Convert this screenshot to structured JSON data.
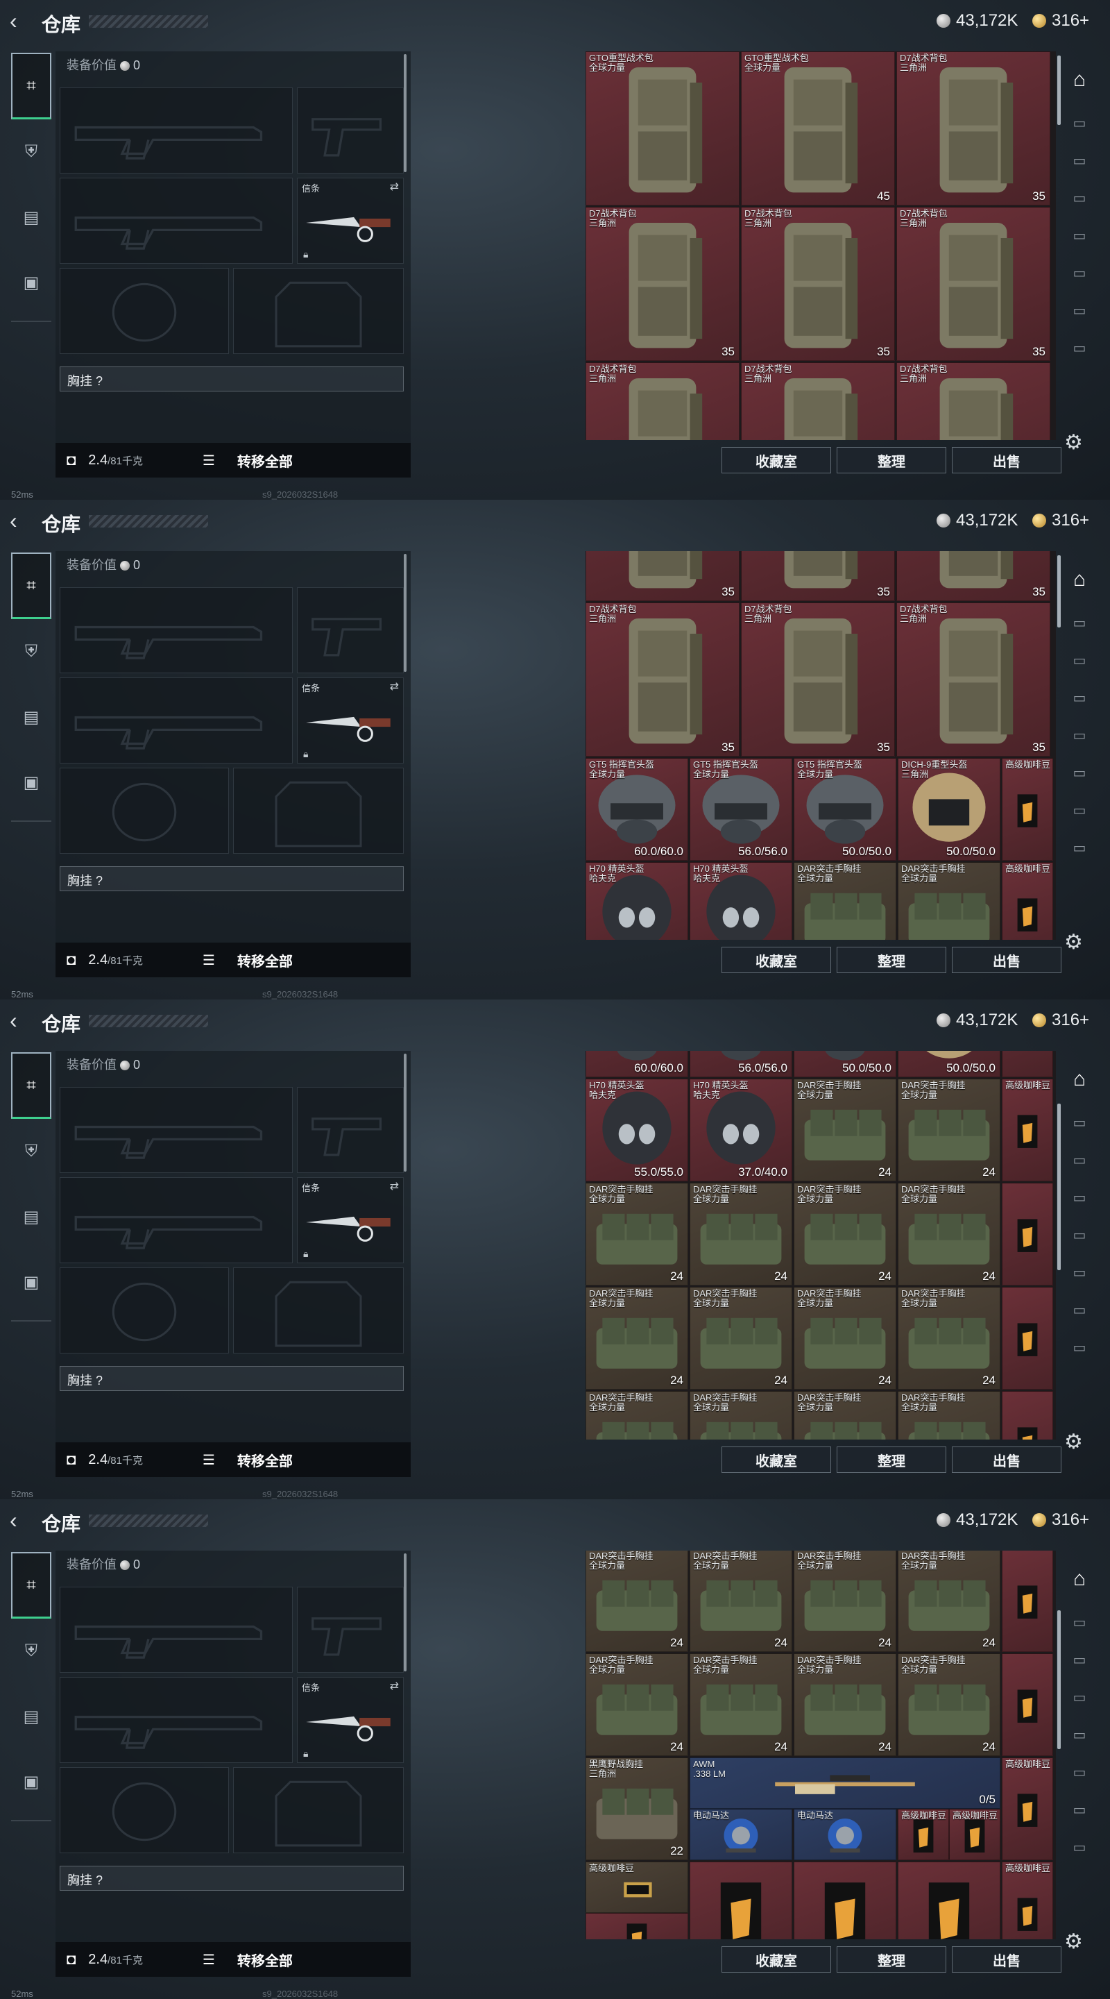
{
  "header": {
    "title": "仓库",
    "silver": "43,172K",
    "gold": "316+"
  },
  "status": {
    "ping": "52ms",
    "build": "s9_2026032S1648"
  },
  "loadout": {
    "value_label": "装备价值",
    "value": "0",
    "knife_label": "信条",
    "chest_rig_label": "胸挂",
    "chest_rig_hint": "?",
    "weight": "2.4",
    "weight_max": "/81千克",
    "transfer_all": "转移全部"
  },
  "stash_buttons": {
    "collection": "收藏室",
    "sort": "整理",
    "sell": "出售"
  },
  "frames": [
    {
      "cells": [
        {
          "name": "GTO重型战术包",
          "sub": "全球力量",
          "count": "",
          "bg": "red",
          "kind": "bag"
        },
        {
          "name": "GTO重型战术包",
          "sub": "全球力量",
          "count": "45",
          "bg": "red",
          "kind": "bag"
        },
        {
          "name": "D7战术背包",
          "sub": "三角洲",
          "count": "35",
          "bg": "red",
          "kind": "bag"
        },
        {
          "name": "D7战术背包",
          "sub": "三角洲",
          "count": "35",
          "bg": "red",
          "kind": "bag"
        },
        {
          "name": "D7战术背包",
          "sub": "三角洲",
          "count": "35",
          "bg": "red",
          "kind": "bag"
        },
        {
          "name": "D7战术背包",
          "sub": "三角洲",
          "count": "35",
          "bg": "red",
          "kind": "bag"
        },
        {
          "name": "D7战术背包",
          "sub": "三角洲",
          "count": "",
          "bg": "red",
          "kind": "bag"
        },
        {
          "name": "D7战术背包",
          "sub": "三角洲",
          "count": "",
          "bg": "red",
          "kind": "bag"
        },
        {
          "name": "D7战术背包",
          "sub": "三角洲",
          "count": "",
          "bg": "red",
          "kind": "bag"
        }
      ],
      "first_count": "45"
    },
    {
      "cells": [
        {
          "name": "D7战术背包",
          "sub": "三角洲",
          "count": "35",
          "bg": "red",
          "kind": "bag"
        },
        {
          "name": "D7战术背包",
          "sub": "三角洲",
          "count": "35",
          "bg": "red",
          "kind": "bag"
        },
        {
          "name": "D7战术背包",
          "sub": "三角洲",
          "count": "35",
          "bg": "red",
          "kind": "bag"
        },
        {
          "name": "GT5 指挥官头盔",
          "sub": "全球力量",
          "count": "60.0/60.0",
          "bg": "red",
          "kind": "helmet"
        },
        {
          "name": "GT5 指挥官头盔",
          "sub": "全球力量",
          "count": "56.0/56.0",
          "bg": "red",
          "kind": "helmet"
        },
        {
          "name": "GT5 指挥官头盔",
          "sub": "全球力量",
          "count": "50.0/50.0",
          "bg": "red",
          "kind": "helmet"
        },
        {
          "name": "DICH-9重型头盔",
          "sub": "三角洲",
          "count": "50.0/50.0",
          "bg": "red",
          "kind": "helmet2"
        },
        {
          "name": "高级咖啡豆",
          "sub": "",
          "count": "",
          "bg": "red",
          "kind": "coffee"
        },
        {
          "name": "H70 精英头盔",
          "sub": "哈夫克",
          "count": "",
          "bg": "red",
          "kind": "helmet3"
        },
        {
          "name": "H70 精英头盔",
          "sub": "哈夫克",
          "count": "",
          "bg": "red",
          "kind": "helmet3"
        },
        {
          "name": "DAR突击手胸挂",
          "sub": "全球力量",
          "count": "",
          "bg": "brn",
          "kind": "rig"
        },
        {
          "name": "DAR突击手胸挂",
          "sub": "全球力量",
          "count": "",
          "bg": "brn",
          "kind": "rig"
        },
        {
          "name": "高级咖啡豆",
          "sub": "",
          "count": "",
          "bg": "red",
          "kind": "coffee"
        }
      ]
    },
    {
      "cells": [
        {
          "name": "H70 精英头盔",
          "sub": "哈夫克",
          "count": "55.0/55.0",
          "bg": "red",
          "kind": "helmet3"
        },
        {
          "name": "H70 精英头盔",
          "sub": "哈夫克",
          "count": "37.0/40.0",
          "bg": "red",
          "kind": "helmet3"
        },
        {
          "name": "DAR突击手胸挂",
          "sub": "全球力量",
          "count": "24",
          "bg": "brn",
          "kind": "rig"
        },
        {
          "name": "DAR突击手胸挂",
          "sub": "全球力量",
          "count": "24",
          "bg": "brn",
          "kind": "rig"
        },
        {
          "name": "高级咖啡豆",
          "sub": "",
          "count": "",
          "bg": "red",
          "kind": "coffee"
        }
      ],
      "top_counts": [
        "60.0/60.0",
        "56.0/56.0",
        "50.0/50.0",
        "50.0/50.0"
      ],
      "rig_name": "DAR突击手胸挂",
      "rig_sub": "全球力量",
      "rig_count": "24"
    },
    {
      "cells": [
        {
          "name": "黑鹰野战胸挂",
          "sub": "三角洲",
          "count": "22",
          "bg": "brn",
          "kind": "rig2"
        },
        {
          "name": "AWM",
          ".sub": "",
          "sub": ".338 LM",
          "count": "0/5",
          "bg": "blu",
          "kind": "rifle"
        },
        {
          "name": "高级咖啡豆",
          "sub": "",
          "count": "",
          "bg": "red",
          "kind": "coffee"
        },
        {
          "name": "电动马达",
          "sub": "",
          "count": "",
          "bg": "blu",
          "kind": "motor"
        },
        {
          "name": "电动马达",
          "sub": "",
          "count": "",
          "bg": "blu",
          "kind": "motor"
        },
        {
          "name": "高级咖啡豆",
          "sub": "",
          "count": "",
          "bg": "red",
          "kind": "coffee"
        },
        {
          "name": "高级咖啡豆",
          "sub": "",
          "count": "",
          "bg": "red",
          "kind": "coffee"
        },
        {
          "name": "高级咖啡豆",
          "sub": "",
          "count": "",
          "bg": "red",
          "kind": "coffee"
        },
        {
          "name": "高级咖啡豆",
          "sub": "",
          "count": "",
          "bg": "brn",
          "kind": "gold"
        }
      ]
    }
  ]
}
